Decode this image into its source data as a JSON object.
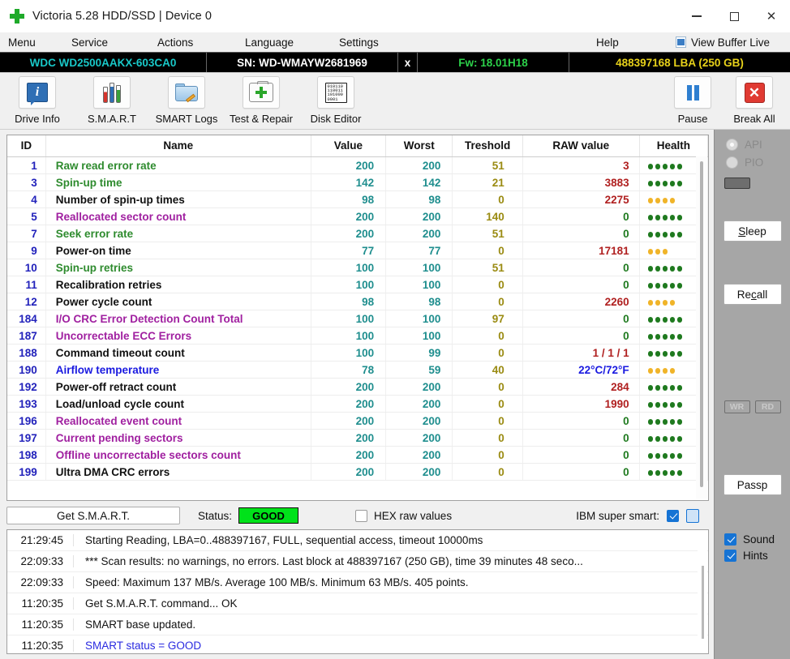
{
  "window": {
    "title": "Victoria 5.28 HDD/SSD | Device 0",
    "app_icon": "green-cross-icon",
    "minimize": "–",
    "maximize": "□",
    "close": "✕"
  },
  "menubar": {
    "items": [
      {
        "label": "Menu"
      },
      {
        "label": "Service"
      },
      {
        "label": "Actions"
      },
      {
        "label": "Language"
      },
      {
        "label": "Settings"
      },
      {
        "label": "Help"
      }
    ],
    "view_buffer_live": "View Buffer Live"
  },
  "drivebar": {
    "model": "WDC WD2500AAKX-603CA0",
    "serial": "SN: WD-WMAYW2681969",
    "close_x": "x",
    "firmware": "Fw: 18.01H18",
    "capacity": "488397168 LBA (250 GB)",
    "colors": {
      "model": "#19c8c8",
      "serial": "#ffffff",
      "firmware": "#2cd24a",
      "capacity": "#e8d21a",
      "background": "#000000"
    }
  },
  "toolbar": {
    "left_buttons": [
      {
        "label": "Drive Info",
        "icon": "info-panel-icon"
      },
      {
        "label": "S.M.A.R.T",
        "icon": "test-tubes-icon"
      },
      {
        "label": "SMART Logs",
        "icon": "folder-pencil-icon"
      },
      {
        "label": "Test & Repair",
        "icon": "first-aid-kit-icon"
      },
      {
        "label": "Disk Editor",
        "icon": "hex-page-icon"
      }
    ],
    "right_buttons": [
      {
        "label": "Pause",
        "icon": "pause-icon"
      },
      {
        "label": "Break All",
        "icon": "red-x-icon"
      }
    ]
  },
  "table": {
    "headers": [
      "ID",
      "Name",
      "Value",
      "Worst",
      "Treshold",
      "RAW value",
      "Health"
    ],
    "rows": [
      {
        "id": "1",
        "name": "Raw read error rate",
        "name_color": "#2e8b2e",
        "value": "200",
        "worst": "200",
        "threshold": "51",
        "raw": "3",
        "health_dots": 5,
        "health_color": "#1f7a1f"
      },
      {
        "id": "3",
        "name": "Spin-up time",
        "name_color": "#2e8b2e",
        "value": "142",
        "worst": "142",
        "threshold": "21",
        "raw": "3883",
        "health_dots": 5,
        "health_color": "#1f7a1f"
      },
      {
        "id": "4",
        "name": "Number of spin-up times",
        "name_color": "#111111",
        "value": "98",
        "worst": "98",
        "threshold": "0",
        "raw": "2275",
        "health_dots": 4,
        "health_color": "#f0b429"
      },
      {
        "id": "5",
        "name": "Reallocated sector count",
        "name_color": "#a020a0",
        "value": "200",
        "worst": "200",
        "threshold": "140",
        "raw": "0",
        "health_dots": 5,
        "health_color": "#1f7a1f",
        "raw_color": "#1f7a1f"
      },
      {
        "id": "7",
        "name": "Seek error rate",
        "name_color": "#2e8b2e",
        "value": "200",
        "worst": "200",
        "threshold": "51",
        "raw": "0",
        "health_dots": 5,
        "health_color": "#1f7a1f",
        "raw_color": "#1f7a1f"
      },
      {
        "id": "9",
        "name": "Power-on time",
        "name_color": "#111111",
        "value": "77",
        "worst": "77",
        "threshold": "0",
        "raw": "17181",
        "health_dots": 3,
        "health_color": "#f0b429"
      },
      {
        "id": "10",
        "name": "Spin-up retries",
        "name_color": "#2e8b2e",
        "value": "100",
        "worst": "100",
        "threshold": "51",
        "raw": "0",
        "health_dots": 5,
        "health_color": "#1f7a1f",
        "raw_color": "#1f7a1f"
      },
      {
        "id": "11",
        "name": "Recalibration retries",
        "name_color": "#111111",
        "value": "100",
        "worst": "100",
        "threshold": "0",
        "raw": "0",
        "health_dots": 5,
        "health_color": "#1f7a1f",
        "raw_color": "#1f7a1f"
      },
      {
        "id": "12",
        "name": "Power cycle count",
        "name_color": "#111111",
        "value": "98",
        "worst": "98",
        "threshold": "0",
        "raw": "2260",
        "health_dots": 4,
        "health_color": "#f0b429"
      },
      {
        "id": "184",
        "name": "I/O CRC Error Detection Count Total",
        "name_color": "#a020a0",
        "value": "100",
        "worst": "100",
        "threshold": "97",
        "raw": "0",
        "health_dots": 5,
        "health_color": "#1f7a1f",
        "raw_color": "#1f7a1f"
      },
      {
        "id": "187",
        "name": "Uncorrectable ECC Errors",
        "name_color": "#a020a0",
        "value": "100",
        "worst": "100",
        "threshold": "0",
        "raw": "0",
        "health_dots": 5,
        "health_color": "#1f7a1f",
        "raw_color": "#1f7a1f"
      },
      {
        "id": "188",
        "name": "Command timeout count",
        "name_color": "#111111",
        "value": "100",
        "worst": "99",
        "threshold": "0",
        "raw": "1 / 1 / 1",
        "health_dots": 5,
        "health_color": "#1f7a1f"
      },
      {
        "id": "190",
        "name": "Airflow temperature",
        "name_color": "#1a1ae0",
        "value": "78",
        "worst": "59",
        "threshold": "40",
        "raw": "22°C/72°F",
        "health_dots": 4,
        "health_color": "#f0b429",
        "raw_color": "#1a1ae0"
      },
      {
        "id": "192",
        "name": "Power-off retract count",
        "name_color": "#111111",
        "value": "200",
        "worst": "200",
        "threshold": "0",
        "raw": "284",
        "health_dots": 5,
        "health_color": "#1f7a1f"
      },
      {
        "id": "193",
        "name": "Load/unload cycle count",
        "name_color": "#111111",
        "value": "200",
        "worst": "200",
        "threshold": "0",
        "raw": "1990",
        "health_dots": 5,
        "health_color": "#1f7a1f"
      },
      {
        "id": "196",
        "name": "Reallocated event count",
        "name_color": "#a020a0",
        "value": "200",
        "worst": "200",
        "threshold": "0",
        "raw": "0",
        "health_dots": 5,
        "health_color": "#1f7a1f",
        "raw_color": "#1f7a1f"
      },
      {
        "id": "197",
        "name": "Current pending sectors",
        "name_color": "#a020a0",
        "value": "200",
        "worst": "200",
        "threshold": "0",
        "raw": "0",
        "health_dots": 5,
        "health_color": "#1f7a1f",
        "raw_color": "#1f7a1f"
      },
      {
        "id": "198",
        "name": "Offline uncorrectable sectors count",
        "name_color": "#a020a0",
        "value": "200",
        "worst": "200",
        "threshold": "0",
        "raw": "0",
        "health_dots": 5,
        "health_color": "#1f7a1f",
        "raw_color": "#1f7a1f"
      },
      {
        "id": "199",
        "name": "Ultra DMA CRC errors",
        "name_color": "#111111",
        "value": "200",
        "worst": "200",
        "threshold": "0",
        "raw": "0",
        "health_dots": 5,
        "health_color": "#1f7a1f",
        "raw_color": "#1f7a1f"
      }
    ]
  },
  "smartbar": {
    "get_smart": "Get S.M.A.R.T.",
    "status_label": "Status:",
    "status_value": "GOOD",
    "status_color": "#00e21a",
    "hex_label": "HEX raw values",
    "hex_checked": false,
    "ibm_label": "IBM super smart:",
    "ibm_checked": true
  },
  "log": {
    "rows": [
      {
        "time": "21:29:45",
        "msg": "Starting Reading, LBA=0..488397167, FULL, sequential access, timeout 10000ms",
        "color": "black"
      },
      {
        "time": "22:09:33",
        "msg": "*** Scan results: no warnings, no errors. Last block at 488397167 (250 GB), time 39 minutes 48 seco...",
        "color": "black"
      },
      {
        "time": "22:09:33",
        "msg": "Speed: Maximum 137 MB/s. Average 100 MB/s. Minimum 63 MB/s. 405 points.",
        "color": "black"
      },
      {
        "time": "11:20:35",
        "msg": "Get S.M.A.R.T. command... OK",
        "color": "black"
      },
      {
        "time": "11:20:35",
        "msg": "SMART base updated.",
        "color": "black"
      },
      {
        "time": "11:20:35",
        "msg": "SMART status = GOOD",
        "color": "blue"
      }
    ]
  },
  "right_panel": {
    "api_label": "API",
    "pio_label": "PIO",
    "api_selected": true,
    "pio_selected": false,
    "sleep_label": "Sleep",
    "recall_label": "Recall",
    "wr_label": "WR",
    "rd_label": "RD",
    "passp_label": "Passp",
    "sound_label": "Sound",
    "hints_label": "Hints",
    "sound_checked": true,
    "hints_checked": true
  }
}
